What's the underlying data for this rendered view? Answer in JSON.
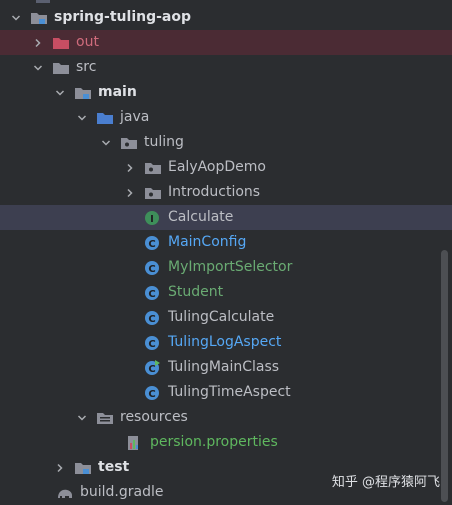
{
  "tree": {
    "root": {
      "label": "spring-tuling-aop"
    },
    "out": {
      "label": "out"
    },
    "src": {
      "label": "src"
    },
    "main": {
      "label": "main"
    },
    "java": {
      "label": "java"
    },
    "tuling": {
      "label": "tuling"
    },
    "items": [
      {
        "label": "EalyAopDemo",
        "kind": "package"
      },
      {
        "label": "Introductions",
        "kind": "package"
      },
      {
        "label": "Calculate",
        "kind": "interface"
      },
      {
        "label": "MainConfig",
        "kind": "class"
      },
      {
        "label": "MyImportSelector",
        "kind": "class"
      },
      {
        "label": "Student",
        "kind": "class"
      },
      {
        "label": "TulingCalculate",
        "kind": "class"
      },
      {
        "label": "TulingLogAspect",
        "kind": "class"
      },
      {
        "label": "TulingMainClass",
        "kind": "class-main"
      },
      {
        "label": "TulingTimeAspect",
        "kind": "class"
      }
    ],
    "resources": {
      "label": "resources"
    },
    "properties": {
      "label": "persion.properties"
    },
    "test": {
      "label": "test"
    },
    "gradle": {
      "label": "build.gradle"
    }
  },
  "watermark": "知乎 @程序猿阿飞",
  "colors": {
    "background": "#2b2d30",
    "selected_row": "#3d3f50",
    "excluded_row": "#4b2b34",
    "class_icon": "#4a8fd4",
    "interface_icon": "#3e8f5a",
    "label_blue": "#56a8f5",
    "label_green": "#6aab73",
    "label_red": "#cf6b7c"
  }
}
